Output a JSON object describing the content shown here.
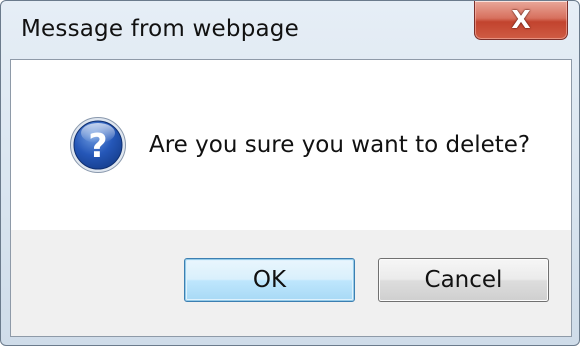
{
  "dialog": {
    "title": "Message from webpage",
    "close_glyph": "X",
    "icon": "question-icon",
    "message": "Are you sure you want to delete?",
    "buttons": {
      "ok_label": "OK",
      "cancel_label": "Cancel"
    },
    "colors": {
      "close_button": "#c2432e",
      "icon_blue": "#1f4fa8",
      "default_button_border": "#3c7fb1"
    }
  }
}
